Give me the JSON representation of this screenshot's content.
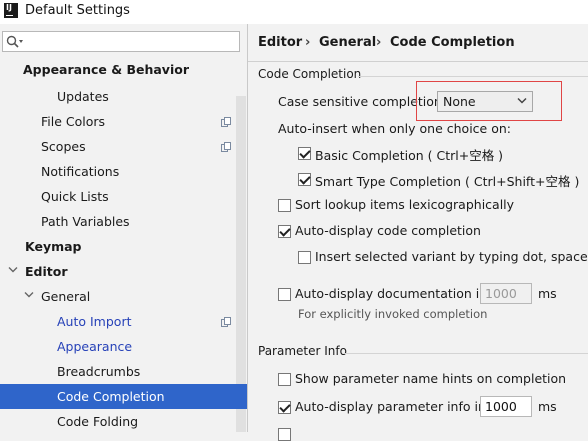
{
  "window": {
    "title": "Default Settings"
  },
  "sidebar": {
    "search_placeholder": "",
    "items": [
      {
        "label": "Appearance & Behavior"
      },
      {
        "label": "Updates"
      },
      {
        "label": "File Colors"
      },
      {
        "label": "Scopes"
      },
      {
        "label": "Notifications"
      },
      {
        "label": "Quick Lists"
      },
      {
        "label": "Path Variables"
      },
      {
        "label": "Keymap"
      },
      {
        "label": "Editor"
      },
      {
        "label": "General"
      },
      {
        "label": "Auto Import"
      },
      {
        "label": "Appearance"
      },
      {
        "label": "Breadcrumbs"
      },
      {
        "label": "Code Completion"
      },
      {
        "label": "Code Folding"
      }
    ]
  },
  "breadcrumb": {
    "items": [
      "Editor",
      "General",
      "Code Completion"
    ],
    "separator": "›"
  },
  "code_completion": {
    "section_title": "Code Completion",
    "case_label": "Case sensitive completion:",
    "case_value": "None",
    "auto_insert_label": "Auto-insert when only one choice on:",
    "basic_completion": "Basic Completion ( Ctrl+空格 )",
    "smart_completion": "Smart Type Completion ( Ctrl+Shift+空格 )",
    "sort_lexico": "Sort lookup items lexicographically",
    "auto_display": "Auto-display code completion",
    "insert_variant": "Insert selected variant by typing dot, space, etc",
    "auto_doc": "Auto-display documentation in",
    "auto_doc_value": "1000",
    "auto_doc_unit": "ms",
    "auto_doc_hint": "For explicitly invoked completion"
  },
  "parameter_info": {
    "section_title": "Parameter Info",
    "show_hints": "Show parameter name hints on completion",
    "auto_display_info": "Auto-display parameter info in",
    "auto_display_value": "1000",
    "auto_display_unit": "ms"
  },
  "colors": {
    "selection": "#2f65ca",
    "link": "#2742b8",
    "highlight_border": "#e04545"
  }
}
